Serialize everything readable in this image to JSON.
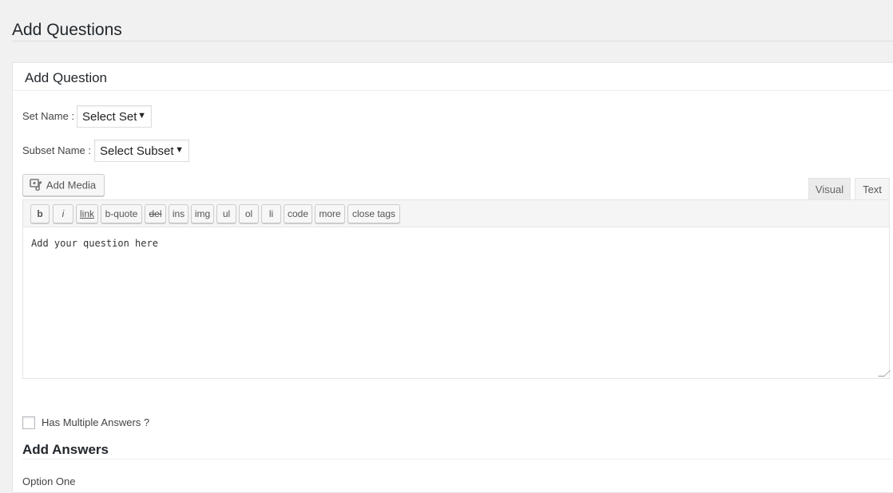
{
  "page": {
    "title": "Add Questions"
  },
  "panel": {
    "heading": "Add Question"
  },
  "set_field": {
    "label": "Set Name :",
    "value": "Select Set"
  },
  "subset_field": {
    "label": "Subset Name :",
    "value": "Select Subset"
  },
  "media": {
    "button_label": "Add Media",
    "icon": "add-media-icon"
  },
  "editor_tabs": {
    "visual": "Visual",
    "text": "Text",
    "active": "text"
  },
  "toolbar": {
    "buttons": [
      "b",
      "i",
      "link",
      "b-quote",
      "del",
      "ins",
      "img",
      "ul",
      "ol",
      "li",
      "code",
      "more",
      "close tags"
    ]
  },
  "editor": {
    "content": "Add your question here"
  },
  "multiple_answers": {
    "label": "Has Multiple Answers ?",
    "checked": false
  },
  "answers": {
    "heading": "Add Answers",
    "first_option_label": "Option One"
  },
  "colors": {
    "background": "#f1f1f1",
    "panel": "#ffffff",
    "text": "#444444"
  }
}
